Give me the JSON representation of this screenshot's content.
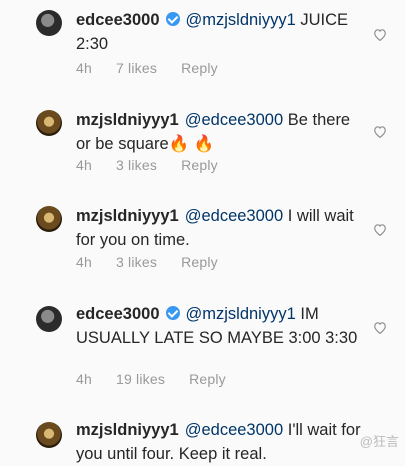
{
  "comments": [
    {
      "username": "edcee3000",
      "verified": true,
      "mention": "@mzjsldniyyy1",
      "text": "JUICE 2:30",
      "time": "4h",
      "likes": "7 likes",
      "reply": "Reply"
    },
    {
      "username": "mzjsldniyyy1",
      "verified": false,
      "mention": "@edcee3000",
      "text": "Be there or be square🔥 🔥",
      "time": "4h",
      "likes": "3 likes",
      "reply": "Reply"
    },
    {
      "username": "mzjsldniyyy1",
      "verified": false,
      "mention": "@edcee3000",
      "text": "I will wait for you on time.",
      "time": "4h",
      "likes": "3 likes",
      "reply": "Reply"
    },
    {
      "username": "edcee3000",
      "verified": true,
      "mention": "@mzjsldniyyy1",
      "text": "IM USUALLY LATE SO MAYBE 3:00 3:30",
      "time": "4h",
      "likes": "19 likes",
      "reply": "Reply"
    },
    {
      "username": "mzjsldniyyy1",
      "verified": false,
      "mention": "@edcee3000",
      "text": "I'll wait for you until four. Keep it real.",
      "time": "",
      "likes": "",
      "reply": ""
    }
  ],
  "icons": {
    "like": "heart-outline-icon",
    "verified": "verified-badge-icon"
  },
  "colors": {
    "mention": "#003569",
    "meta": "#999999",
    "verified": "#3897f0"
  },
  "watermark": "@狂言"
}
